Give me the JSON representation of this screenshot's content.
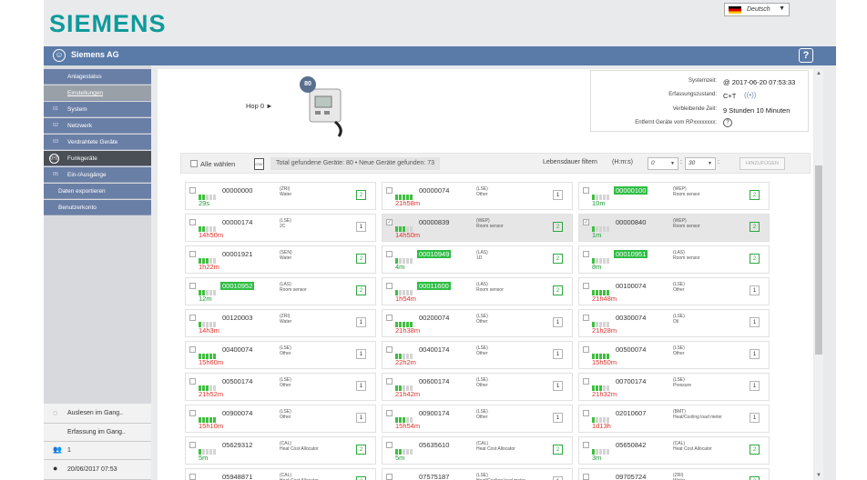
{
  "logo": "SIEMENS",
  "topbar": {
    "title": "Siemens AG",
    "language": "Deutsch",
    "help": "?"
  },
  "sidebar": {
    "items": [
      {
        "label": "Anlagestatus",
        "num": ""
      },
      {
        "label": "Einstellungen",
        "num": ""
      },
      {
        "label": "System",
        "num": "01"
      },
      {
        "label": "Netzwerk",
        "num": "02"
      },
      {
        "label": "Verdrahtete Geräte",
        "num": "03"
      },
      {
        "label": "Funkgeräte",
        "num": "04"
      },
      {
        "label": "Ein-/Ausgänge",
        "num": "05"
      },
      {
        "label": "Daten exportieren",
        "num": ""
      },
      {
        "label": "Benutzerkonto",
        "num": ""
      }
    ],
    "status": {
      "reading": "Auslesen im Gang..",
      "capture": "Erfassung im Gang..",
      "users": "1",
      "datetime": "20/06/2017 07:53"
    }
  },
  "hop": "Hop 0 ►",
  "device_badge": "80",
  "system": {
    "time_label": "Systemzeit:",
    "time_value": "@ 2017-06-20 07:53:33",
    "state_label": "Erfassungszustand:",
    "state_value": "C+T",
    "remaining_label": "Verbleibende Zeit:",
    "remaining_value": "9 Stunden 10 Minuten",
    "remove_label": "Entfernt Geräte vom RPxxxxxxxx:",
    "remove_icon": "?"
  },
  "filter": {
    "select_all": "Alle wählen",
    "found": "Total gefundene Geräte: 80  •  Neue Geräte gefunden: 73",
    "lifetime_label": "Lebensdauer filtern",
    "format": "(H:m:s)",
    "h": "0",
    "m": "30",
    "s": "0",
    "add_button": "HINZUFÜGEN"
  },
  "cards": [
    {
      "addr": "00000000",
      "new": false,
      "time": "29s",
      "tc": "green",
      "t1": "(ZRI)",
      "t2": "Water",
      "num": "2",
      "bars": 2,
      "sel": false,
      "chk": false
    },
    {
      "addr": "00000074",
      "new": false,
      "time": "21h58m",
      "tc": "red",
      "t1": "(LSE)",
      "t2": "Other",
      "num": "1",
      "bars": 5,
      "sel": false,
      "chk": false
    },
    {
      "addr": "00000100",
      "new": true,
      "time": "10m",
      "tc": "green",
      "t1": "(WEP)",
      "t2": "Room sensor",
      "num": "2",
      "bars": 1,
      "sel": false,
      "chk": false
    },
    {
      "addr": "00000174",
      "new": false,
      "time": "14h50m",
      "tc": "red",
      "t1": "(LSE)",
      "t2": "2C",
      "num": "1",
      "bars": 2,
      "sel": false,
      "chk": false
    },
    {
      "addr": "00000839",
      "new": false,
      "time": "14h50m",
      "tc": "red",
      "t1": "(WEP)",
      "t2": "Room sensor",
      "num": "2",
      "bars": 3,
      "sel": true,
      "chk": true
    },
    {
      "addr": "00000840",
      "new": false,
      "time": "1m",
      "tc": "green",
      "t1": "(WEP)",
      "t2": "Room sensor",
      "num": "2",
      "bars": 1,
      "sel": true,
      "chk": true
    },
    {
      "addr": "00001921",
      "new": false,
      "time": "1h22m",
      "tc": "red",
      "t1": "(SEN)",
      "t2": "Water",
      "num": "2",
      "bars": 3,
      "sel": false,
      "chk": false
    },
    {
      "addr": "00010949",
      "new": true,
      "time": "4m",
      "tc": "green",
      "t1": "(LAS)",
      "t2": "1D",
      "num": "2",
      "bars": 1,
      "sel": false,
      "chk": false
    },
    {
      "addr": "00010951",
      "new": true,
      "time": "8m",
      "tc": "green",
      "t1": "(LAS)",
      "t2": "Room sensor",
      "num": "2",
      "bars": 1,
      "sel": false,
      "chk": false
    },
    {
      "addr": "00010952",
      "new": true,
      "time": "12m",
      "tc": "green",
      "t1": "(LAS)",
      "t2": "Room sensor",
      "num": "2",
      "bars": 2,
      "sel": false,
      "chk": false
    },
    {
      "addr": "00011600",
      "new": true,
      "time": "1h54m",
      "tc": "red",
      "t1": "(LAS)",
      "t2": "Room sensor",
      "num": "2",
      "bars": 1,
      "sel": false,
      "chk": false
    },
    {
      "addr": "00100074",
      "new": false,
      "time": "21h48m",
      "tc": "red",
      "t1": "(LSE)",
      "t2": "Other",
      "num": "1",
      "bars": 5,
      "sel": false,
      "chk": false
    },
    {
      "addr": "00120003",
      "new": false,
      "time": "14h3m",
      "tc": "red",
      "t1": "(ZRI)",
      "t2": "Water",
      "num": "1",
      "bars": 1,
      "sel": false,
      "chk": false
    },
    {
      "addr": "00200074",
      "new": false,
      "time": "21h38m",
      "tc": "red",
      "t1": "(LSE)",
      "t2": "Other",
      "num": "1",
      "bars": 5,
      "sel": false,
      "chk": false
    },
    {
      "addr": "00300074",
      "new": false,
      "time": "21h28m",
      "tc": "red",
      "t1": "(LSE)",
      "t2": "Oil",
      "num": "1",
      "bars": 1,
      "sel": false,
      "chk": false
    },
    {
      "addr": "00400074",
      "new": false,
      "time": "15h60m",
      "tc": "red",
      "t1": "(LSE)",
      "t2": "Other",
      "num": "1",
      "bars": 5,
      "sel": false,
      "chk": false
    },
    {
      "addr": "00400174",
      "new": false,
      "time": "22h2m",
      "tc": "red",
      "t1": "(LSE)",
      "t2": "Other",
      "num": "1",
      "bars": 2,
      "sel": false,
      "chk": false
    },
    {
      "addr": "00500074",
      "new": false,
      "time": "15h50m",
      "tc": "red",
      "t1": "(LSE)",
      "t2": "Other",
      "num": "1",
      "bars": 5,
      "sel": false,
      "chk": false
    },
    {
      "addr": "00500174",
      "new": false,
      "time": "21h52m",
      "tc": "red",
      "t1": "(LSE)",
      "t2": "Other",
      "num": "1",
      "bars": 3,
      "sel": false,
      "chk": false
    },
    {
      "addr": "00600174",
      "new": false,
      "time": "21h42m",
      "tc": "red",
      "t1": "(LSE)",
      "t2": "Other",
      "num": "1",
      "bars": 2,
      "sel": false,
      "chk": false
    },
    {
      "addr": "00700174",
      "new": false,
      "time": "21h32m",
      "tc": "red",
      "t1": "(LSE)",
      "t2": "Pressure",
      "num": "1",
      "bars": 3,
      "sel": false,
      "chk": false
    },
    {
      "addr": "00900074",
      "new": false,
      "time": "15h10m",
      "tc": "red",
      "t1": "(LSE)",
      "t2": "Other",
      "num": "1",
      "bars": 5,
      "sel": false,
      "chk": false
    },
    {
      "addr": "00900174",
      "new": false,
      "time": "15h54m",
      "tc": "red",
      "t1": "(LSE)",
      "t2": "Other",
      "num": "1",
      "bars": 3,
      "sel": false,
      "chk": false
    },
    {
      "addr": "02010607",
      "new": false,
      "time": "1d13h",
      "tc": "red",
      "t1": "(BMT)",
      "t2": "Heat/Cooling load meter",
      "num": "1",
      "bars": 1,
      "sel": false,
      "chk": false
    },
    {
      "addr": "05629312",
      "new": false,
      "time": "5m",
      "tc": "green",
      "t1": "(CAL)",
      "t2": "Heat Cost Allocator",
      "num": "2",
      "bars": 1,
      "sel": false,
      "chk": false
    },
    {
      "addr": "05635610",
      "new": false,
      "time": "5m",
      "tc": "green",
      "t1": "(CAL)",
      "t2": "Heat Cost Allocator",
      "num": "2",
      "bars": 2,
      "sel": false,
      "chk": false
    },
    {
      "addr": "05650842",
      "new": false,
      "time": "3m",
      "tc": "green",
      "t1": "(CAL)",
      "t2": "Heat Cost Allocator",
      "num": "2",
      "bars": 1,
      "sel": false,
      "chk": false
    },
    {
      "addr": "05948871",
      "new": false,
      "time": "",
      "tc": "green",
      "t1": "(CAL)",
      "t2": "Heat Cost Allocator",
      "num": "2",
      "bars": 1,
      "sel": false,
      "chk": false
    },
    {
      "addr": "07575187",
      "new": false,
      "time": "",
      "tc": "red",
      "t1": "(LSE)",
      "t2": "Heat/Cooling load meter",
      "num": "1",
      "bars": 5,
      "sel": false,
      "chk": false
    },
    {
      "addr": "09705724",
      "new": false,
      "time": "",
      "tc": "red",
      "t1": "(ZRI)",
      "t2": "Water",
      "num": "2",
      "bars": 2,
      "sel": false,
      "chk": false
    }
  ]
}
